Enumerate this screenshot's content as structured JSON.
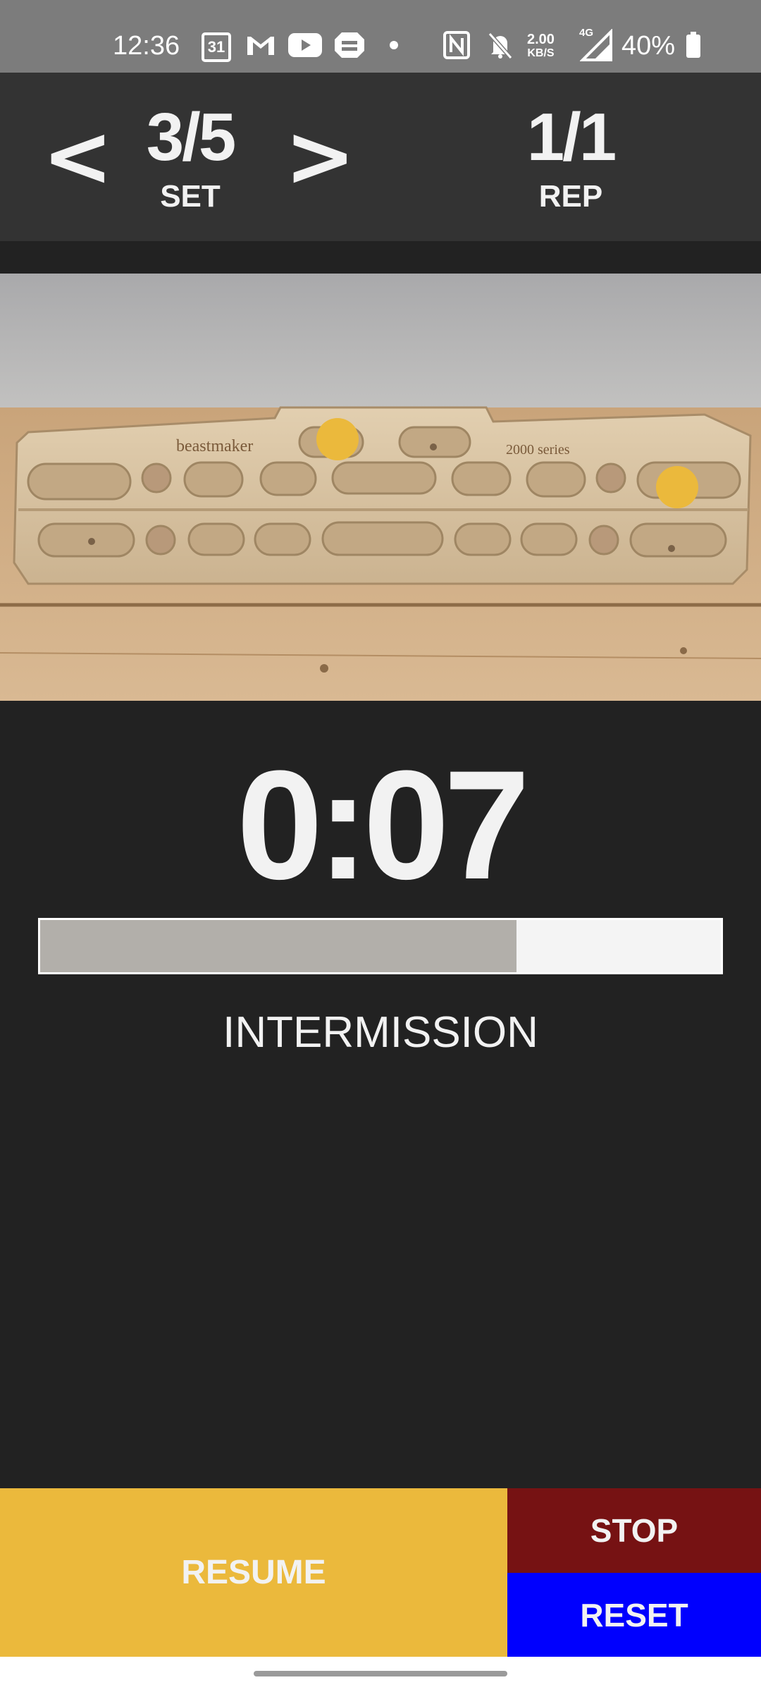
{
  "status_bar": {
    "time": "12:36",
    "calendar_day": "31",
    "net_speed_value": "2.00",
    "net_speed_unit": "KB/S",
    "network_type": "4G",
    "battery": "40%",
    "icons": [
      "calendar-icon",
      "gmail-icon",
      "youtube-icon",
      "printer-icon",
      "dot-icon",
      "nfc-icon",
      "bell-off-icon",
      "signal-icon",
      "battery-icon"
    ]
  },
  "header": {
    "prev_symbol": "<",
    "next_symbol": ">",
    "set_value": "3/5",
    "set_label": "SET",
    "rep_value": "1/1",
    "rep_label": "REP"
  },
  "hangboard": {
    "brand_text": "beastmaker",
    "series_text": "2000 series",
    "marker_color": "#ebb93c",
    "markers": 2
  },
  "timer": {
    "value": "0:07",
    "progress_fraction": 0.7,
    "phase": "INTERMISSION"
  },
  "controls": {
    "resume_label": "RESUME",
    "stop_label": "STOP",
    "reset_label": "RESET"
  },
  "colors": {
    "resume": "#ebb93c",
    "stop": "#761213",
    "reset": "#0000fe",
    "background": "#222222",
    "header": "#333333"
  }
}
